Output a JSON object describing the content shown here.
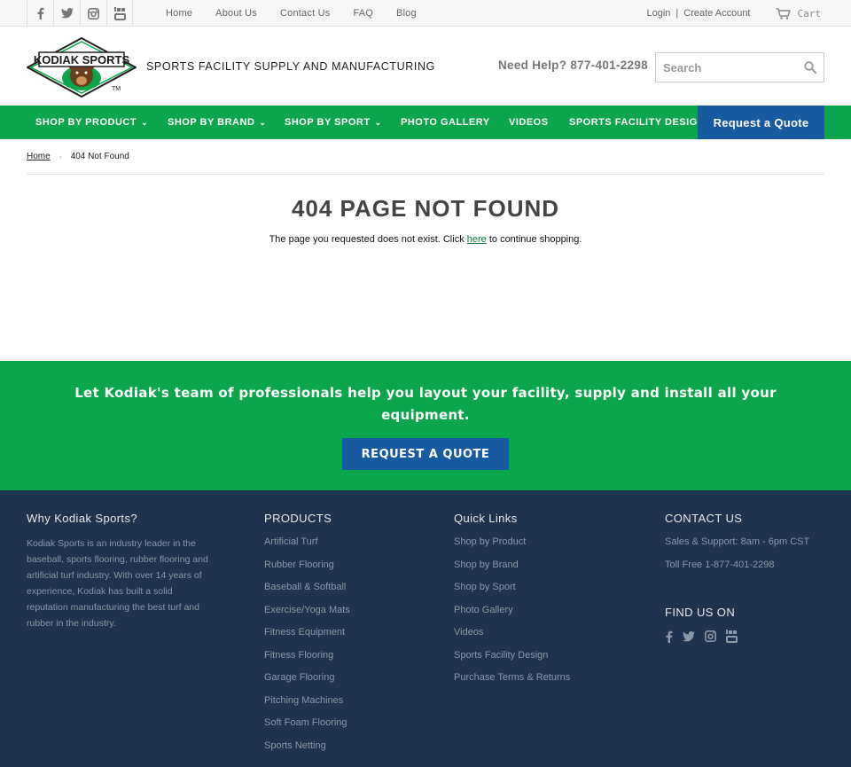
{
  "topbar": {
    "social": [
      "facebook-icon",
      "twitter-icon",
      "instagram-icon",
      "youtube-icon"
    ],
    "links": [
      "Home",
      "About Us",
      "Contact Us",
      "FAQ",
      "Blog"
    ],
    "login": "Login",
    "separator": "|",
    "create_account": "Create Account",
    "cart": "Cart"
  },
  "header": {
    "logo_text": "KODIAK SPORTS",
    "logo_tm": "TM",
    "tagline": "SPORTS FACILITY SUPPLY AND MANUFACTURING",
    "help": "Need Help? 877-401-2298",
    "search_placeholder": "Search"
  },
  "nav": {
    "items": [
      {
        "label": "SHOP BY PRODUCT",
        "chevron": "⌄"
      },
      {
        "label": "SHOP BY BRAND",
        "chevron": "⌄"
      },
      {
        "label": "SHOP BY SPORT",
        "chevron": "⌄"
      },
      {
        "label": "PHOTO GALLERY"
      },
      {
        "label": "VIDEOS"
      },
      {
        "label": "SPORTS FACILITY DESIGN"
      }
    ],
    "quote": "Request a Quote"
  },
  "breadcrumb": {
    "home": "Home",
    "arrow": "›",
    "current": "404 Not Found"
  },
  "main": {
    "heading": "404 PAGE NOT FOUND",
    "message_before": "The page you requested does not exist. Click ",
    "message_link": "here",
    "message_after": " to continue shopping."
  },
  "cta": {
    "text": "Let Kodiak's team of professionals help you layout your facility, supply and install all your equipment.",
    "button": "REQUEST A QUOTE"
  },
  "footer": {
    "why": {
      "title": "Why Kodiak Sports?",
      "text": "Kodiak Sports is an industry leader in the baseball, sports flooring, rubber flooring and artificial turf industry.  With over 14 years of experience, Kodiak has built a solid reputation manufacturing the best turf and rubber in the industry."
    },
    "products": {
      "title": "PRODUCTS",
      "items": [
        "Artificial Turf",
        "Rubber Flooring",
        "Baseball & Softball",
        "Exercise/Yoga Mats",
        "Fitness Equipment",
        "Fitness Flooring",
        "Garage Flooring",
        "Pitching Machines",
        "Soft Foam Flooring",
        "Sports Netting"
      ]
    },
    "quick": {
      "title": "Quick Links",
      "items": [
        "Shop by Product",
        "Shop by Brand",
        "Shop by Sport",
        "Photo Gallery",
        "Videos",
        "Sports Facility Design",
        "Purchase Terms & Returns"
      ]
    },
    "contact": {
      "title": "CONTACT US",
      "hours": "Sales & Support: 8am - 6pm CST",
      "phone": "Toll Free 1-877-401-2298",
      "find_title": "FIND US ON",
      "social": [
        "facebook-icon",
        "twitter-icon",
        "instagram-icon",
        "youtube-icon"
      ]
    }
  },
  "colors": {
    "green": "#0ba54b",
    "blue": "#175aa2",
    "footer": "#1d3350"
  }
}
